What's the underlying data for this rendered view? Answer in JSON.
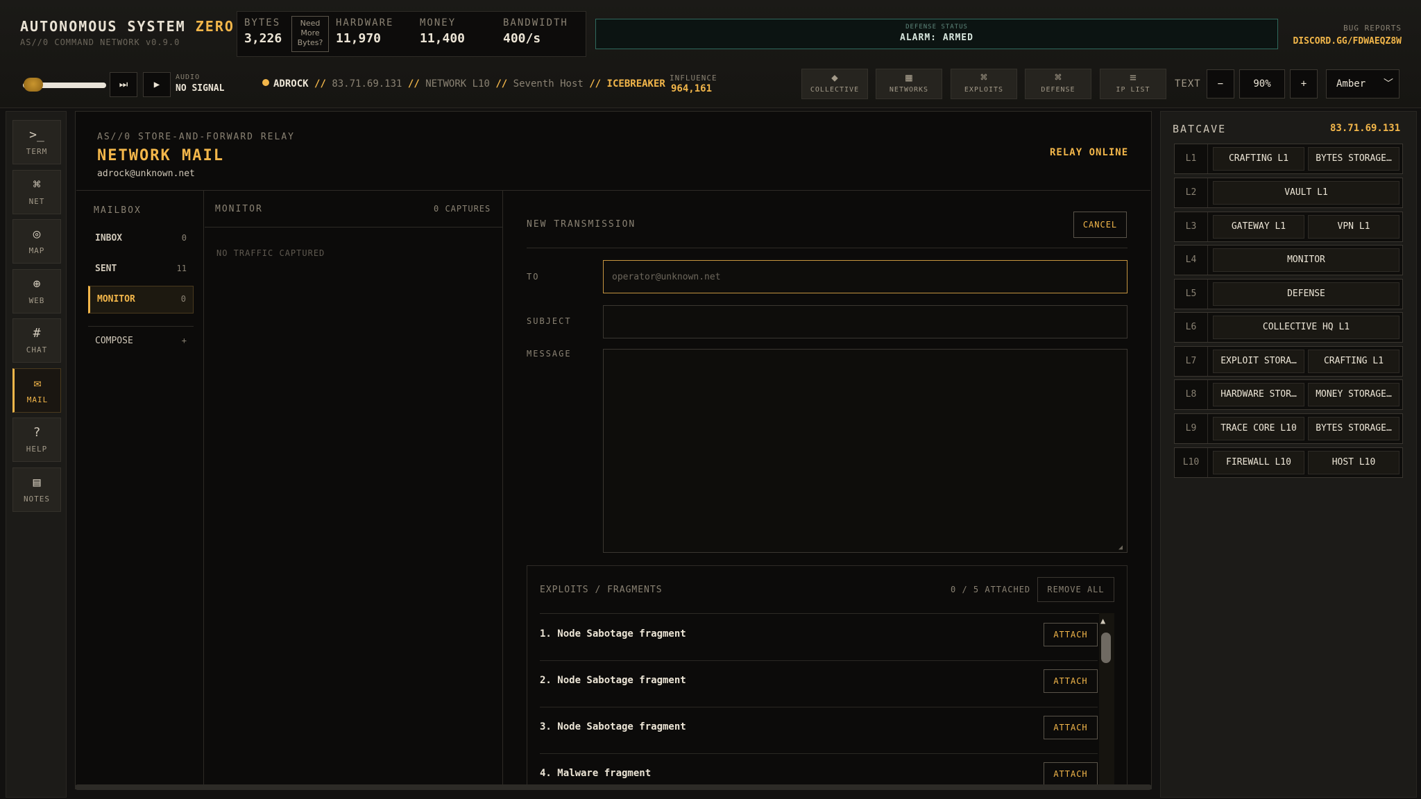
{
  "app": {
    "title_main": "AUTONOMOUS SYSTEM",
    "title_accent": "ZERO",
    "subtitle": "AS//0 COMMAND NETWORK v0.9.0"
  },
  "stats": {
    "bytes_label": "BYTES",
    "bytes_value": "3,226",
    "need_more": "Need More Bytes?",
    "hardware_label": "HARDWARE",
    "hardware_value": "11,970",
    "money_label": "MONEY",
    "money_value": "11,400",
    "bandwidth_label": "BANDWIDTH",
    "bandwidth_value": "400/s"
  },
  "defense_status": {
    "label": "DEFENSE STATUS",
    "value": "ALARM: ARMED"
  },
  "bug_reports": {
    "label": "BUG REPORTS",
    "link": "DISCORD.GG/FDWAEQZ8W"
  },
  "audio": {
    "label": "AUDIO",
    "value": "NO SIGNAL",
    "volume": 0.05
  },
  "status_line": {
    "user": "ADROCK",
    "sep": "//",
    "ip": "83.71.69.131",
    "network": "NETWORK L10",
    "host": "Seventh Host",
    "tool": "ICEBREAKER"
  },
  "influence": {
    "label": "INFLUENCE",
    "value": "964,161"
  },
  "toolbar": [
    {
      "icon": "◆",
      "icon_name": "collective-icon",
      "label": "COLLECTIVE"
    },
    {
      "icon": "▦",
      "icon_name": "networks-icon",
      "label": "NETWORKS"
    },
    {
      "icon": "⌘",
      "icon_name": "exploits-icon",
      "label": "EXPLOITS"
    },
    {
      "icon": "⌘",
      "icon_name": "defense-icon",
      "label": "DEFENSE"
    },
    {
      "icon": "≡",
      "icon_name": "ip-list-icon",
      "label": "IP LIST"
    }
  ],
  "text_controls": {
    "label": "TEXT",
    "minus": "−",
    "value": "90%",
    "plus": "+",
    "theme": "Amber"
  },
  "rail": [
    {
      "icon": ">_",
      "label": "TERM"
    },
    {
      "icon": "⌘",
      "label": "NET"
    },
    {
      "icon": "◎",
      "label": "MAP"
    },
    {
      "icon": "⊕",
      "label": "WEB"
    },
    {
      "icon": "#",
      "label": "CHAT"
    },
    {
      "icon": "✉",
      "label": "MAIL"
    },
    {
      "icon": "?",
      "label": "HELP"
    },
    {
      "icon": "▤",
      "label": "NOTES"
    }
  ],
  "mail": {
    "kicker": "AS//0 STORE-AND-FORWARD RELAY",
    "title": "NETWORK MAIL",
    "address": "adrock@unknown.net",
    "relay_status": "RELAY ONLINE",
    "mailbox_label": "MAILBOX",
    "mailbox": [
      {
        "name": "INBOX",
        "count": "0"
      },
      {
        "name": "SENT",
        "count": "11"
      },
      {
        "name": "MONITOR",
        "count": "0"
      }
    ],
    "compose_label": "COMPOSE",
    "compose_icon": "+",
    "monitor_label": "MONITOR",
    "monitor_captures": "0 CAPTURES",
    "monitor_empty": "NO TRAFFIC CAPTURED",
    "new_transmission": "NEW TRANSMISSION",
    "cancel": "CANCEL",
    "to_label": "TO",
    "to_placeholder": "operator@unknown.net",
    "subject_label": "SUBJECT",
    "message_label": "MESSAGE",
    "exploits_title": "EXPLOITS / FRAGMENTS",
    "exploits_count": "0 / 5 ATTACHED",
    "remove_all": "REMOVE ALL",
    "attach": "ATTACH",
    "exploits": [
      "1. Node Sabotage fragment",
      "2. Node Sabotage fragment",
      "3. Node Sabotage fragment",
      "4. Malware fragment"
    ]
  },
  "batcave": {
    "title": "BATCAVE",
    "ip": "83.71.69.131",
    "levels": [
      {
        "level": "L1",
        "slots": [
          "CRAFTING L1",
          "BYTES STORAGE…"
        ]
      },
      {
        "level": "L2",
        "slots": [
          "VAULT L1"
        ]
      },
      {
        "level": "L3",
        "slots": [
          "GATEWAY L1",
          "VPN L1"
        ]
      },
      {
        "level": "L4",
        "slots": [
          "MONITOR"
        ]
      },
      {
        "level": "L5",
        "slots": [
          "DEFENSE"
        ]
      },
      {
        "level": "L6",
        "slots": [
          "COLLECTIVE HQ L1"
        ]
      },
      {
        "level": "L7",
        "slots": [
          "EXPLOIT STORA…",
          "CRAFTING L1"
        ]
      },
      {
        "level": "L8",
        "slots": [
          "HARDWARE STOR…",
          "MONEY STORAGE…"
        ]
      },
      {
        "level": "L9",
        "slots": [
          "TRACE CORE L10",
          "BYTES STORAGE…"
        ]
      },
      {
        "level": "L10",
        "slots": [
          "FIREWALL L10",
          "HOST L10"
        ]
      }
    ]
  },
  "colors": {
    "accent": "#f2b64a",
    "background": "#0c0b0a",
    "defense": "#2f6a5e"
  }
}
